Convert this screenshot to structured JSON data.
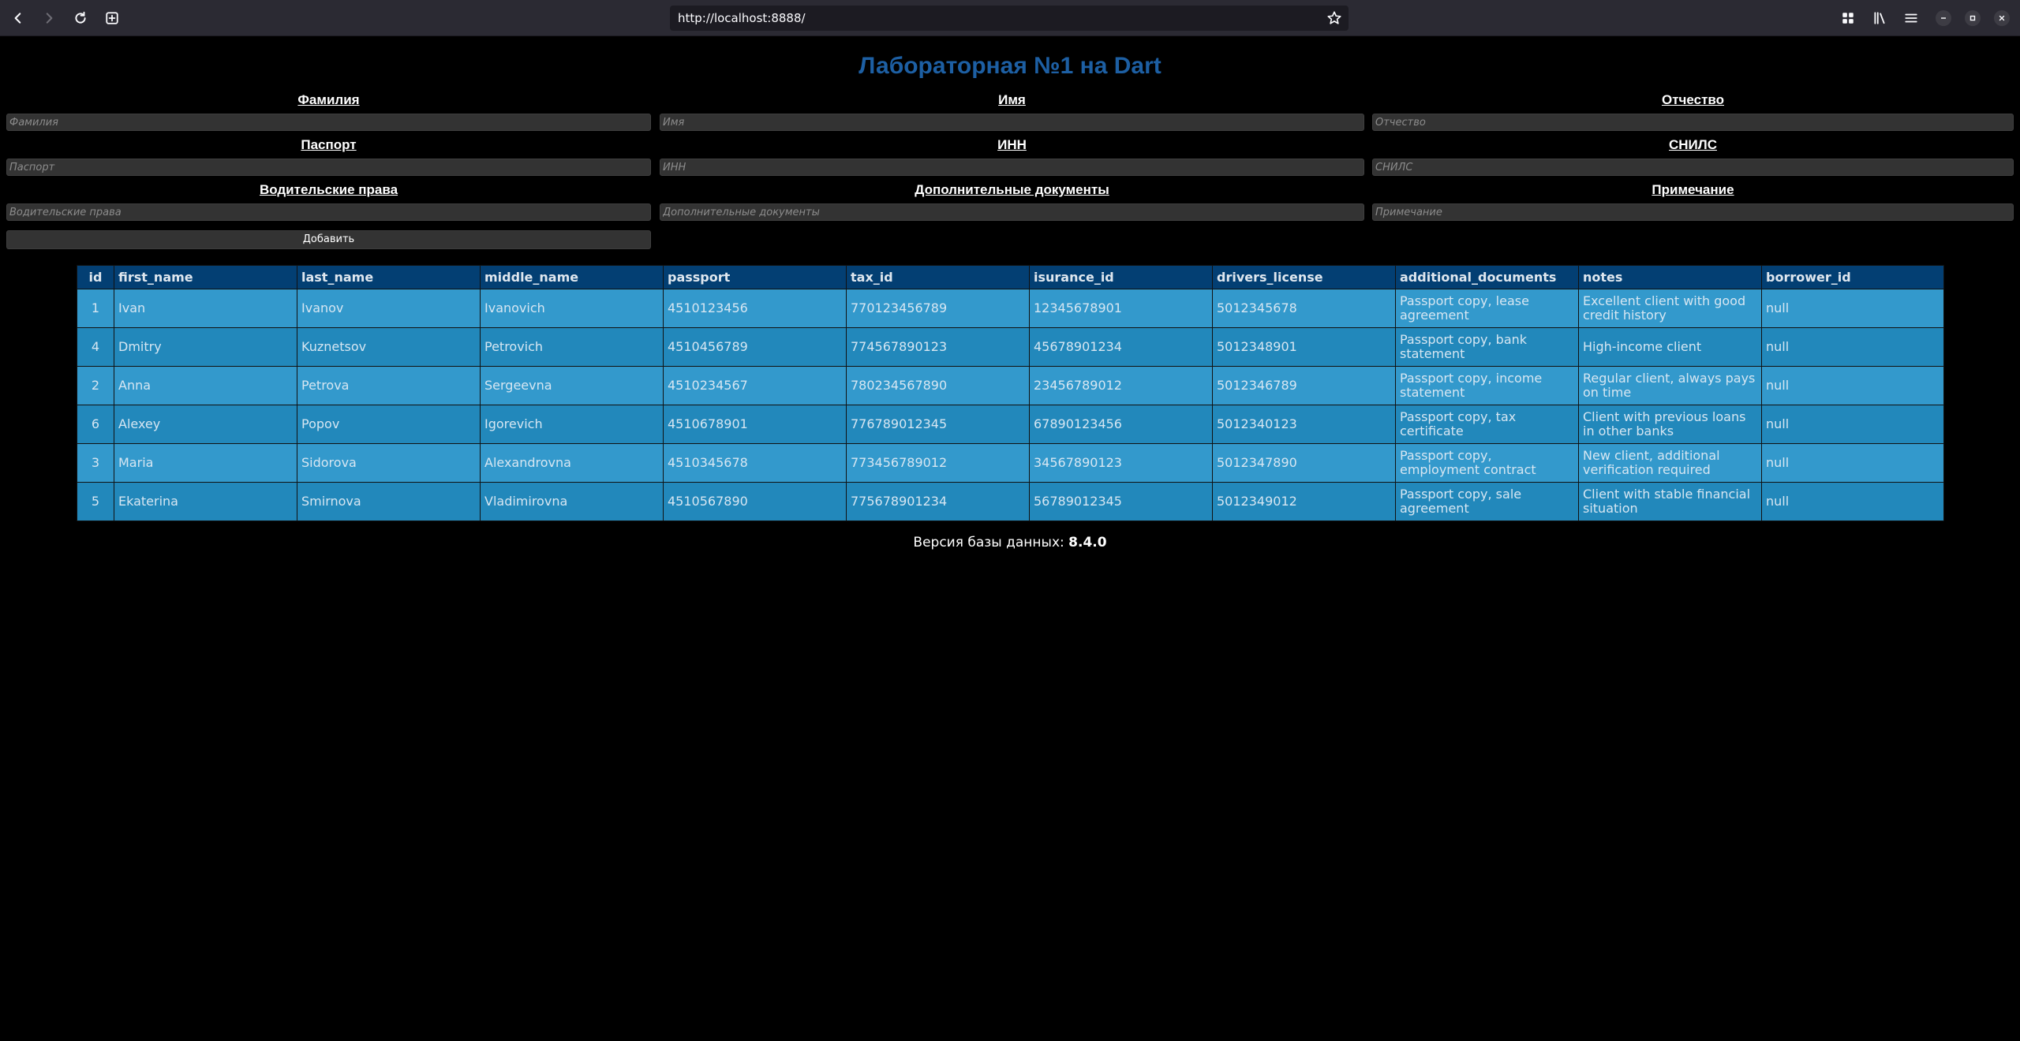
{
  "browser": {
    "url": "http://localhost:8888/"
  },
  "page": {
    "title": "Лабораторная №1 на Dart",
    "form": {
      "fields": [
        {
          "label": "Фамилия",
          "placeholder": "Фамилия",
          "value": ""
        },
        {
          "label": "Имя",
          "placeholder": "Имя",
          "value": ""
        },
        {
          "label": "Отчество",
          "placeholder": "Отчество",
          "value": ""
        },
        {
          "label": "Паспорт",
          "placeholder": "Паспорт",
          "value": ""
        },
        {
          "label": "ИНН",
          "placeholder": "ИНН",
          "value": ""
        },
        {
          "label": "СНИЛС",
          "placeholder": "СНИЛС",
          "value": ""
        },
        {
          "label": "Водительские права",
          "placeholder": "Водительские права",
          "value": ""
        },
        {
          "label": "Дополнительные документы",
          "placeholder": "Дополнительные документы",
          "value": ""
        },
        {
          "label": "Примечание",
          "placeholder": "Примечание",
          "value": ""
        }
      ],
      "add_button_label": "Добавить"
    },
    "table": {
      "columns": [
        "id",
        "first_name",
        "last_name",
        "middle_name",
        "passport",
        "tax_id",
        "isurance_id",
        "drivers_license",
        "additional_documents",
        "notes",
        "borrower_id"
      ],
      "rows": [
        [
          "1",
          "Ivan",
          "Ivanov",
          "Ivanovich",
          "4510123456",
          "770123456789",
          "12345678901",
          "5012345678",
          "Passport copy, lease agreement",
          "Excellent client with good credit history",
          "null"
        ],
        [
          "4",
          "Dmitry",
          "Kuznetsov",
          "Petrovich",
          "4510456789",
          "774567890123",
          "45678901234",
          "5012348901",
          "Passport copy, bank statement",
          "High-income client",
          "null"
        ],
        [
          "2",
          "Anna",
          "Petrova",
          "Sergeevna",
          "4510234567",
          "780234567890",
          "23456789012",
          "5012346789",
          "Passport copy, income statement",
          "Regular client, always pays on time",
          "null"
        ],
        [
          "6",
          "Alexey",
          "Popov",
          "Igorevich",
          "4510678901",
          "776789012345",
          "67890123456",
          "5012340123",
          "Passport copy, tax certificate",
          "Client with previous loans in other banks",
          "null"
        ],
        [
          "3",
          "Maria",
          "Sidorova",
          "Alexandrovna",
          "4510345678",
          "773456789012",
          "34567890123",
          "5012347890",
          "Passport copy, employment contract",
          "New client, additional verification required",
          "null"
        ],
        [
          "5",
          "Ekaterina",
          "Smirnova",
          "Vladimirovna",
          "4510567890",
          "775678901234",
          "56789012345",
          "5012349012",
          "Passport copy, sale agreement",
          "Client with stable financial situation",
          "null"
        ]
      ]
    },
    "db_version_label": "Версия базы данных: ",
    "db_version_value": "8.4.0"
  },
  "colors": {
    "title": "#1d5fa3",
    "table_header": "#033f73",
    "row_odd": "#3399cc",
    "row_even": "#2288bb",
    "input_bg": "#333333",
    "chrome_bg": "#2b2a33"
  },
  "icons": {
    "back": "arrow-left-icon",
    "forward": "arrow-right-icon",
    "reload": "reload-icon",
    "new_tab": "new-tab-icon",
    "bookmark": "star-icon",
    "extensions": "grid-icon",
    "library": "library-icon",
    "menu": "hamburger-menu-icon",
    "minimize": "minimize-icon",
    "maximize": "maximize-icon",
    "close": "close-icon"
  }
}
